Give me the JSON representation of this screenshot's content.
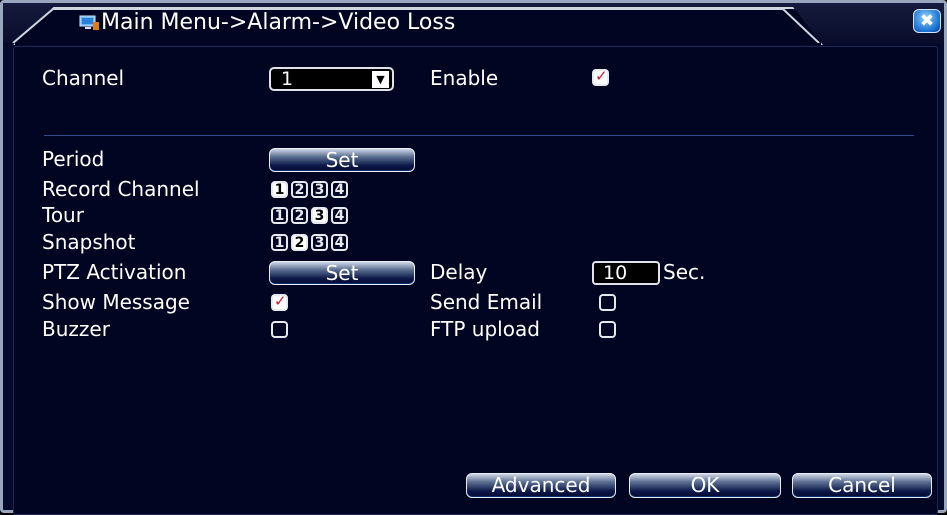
{
  "window": {
    "title": "Main Menu->Alarm->Video Loss",
    "close_symbol": "✖"
  },
  "channel": {
    "label": "Channel",
    "value": "1",
    "arrow": "▼"
  },
  "enable": {
    "label": "Enable",
    "checked": true
  },
  "period": {
    "label": "Period",
    "button": "Set"
  },
  "record_channel": {
    "label": "Record Channel",
    "channels": [
      "1",
      "2",
      "3",
      "4"
    ],
    "selected": [
      "1"
    ]
  },
  "tour": {
    "label": "Tour",
    "channels": [
      "1",
      "2",
      "3",
      "4"
    ],
    "selected": [
      "3"
    ]
  },
  "snapshot": {
    "label": "Snapshot",
    "channels": [
      "1",
      "2",
      "3",
      "4"
    ],
    "selected": [
      "2"
    ]
  },
  "ptz": {
    "label": "PTZ Activation",
    "button": "Set"
  },
  "delay": {
    "label": "Delay",
    "value": "10",
    "unit": "Sec."
  },
  "show_message": {
    "label": "Show Message",
    "checked": true
  },
  "send_email": {
    "label": "Send Email",
    "checked": false
  },
  "buzzer": {
    "label": "Buzzer",
    "checked": false
  },
  "ftp_upload": {
    "label": "FTP upload",
    "checked": false
  },
  "footer": {
    "advanced": "Advanced",
    "ok": "OK",
    "cancel": "Cancel"
  },
  "colors": {
    "background": "#020521",
    "accent": "#1d57b8",
    "check_mark": "#e0102a"
  }
}
